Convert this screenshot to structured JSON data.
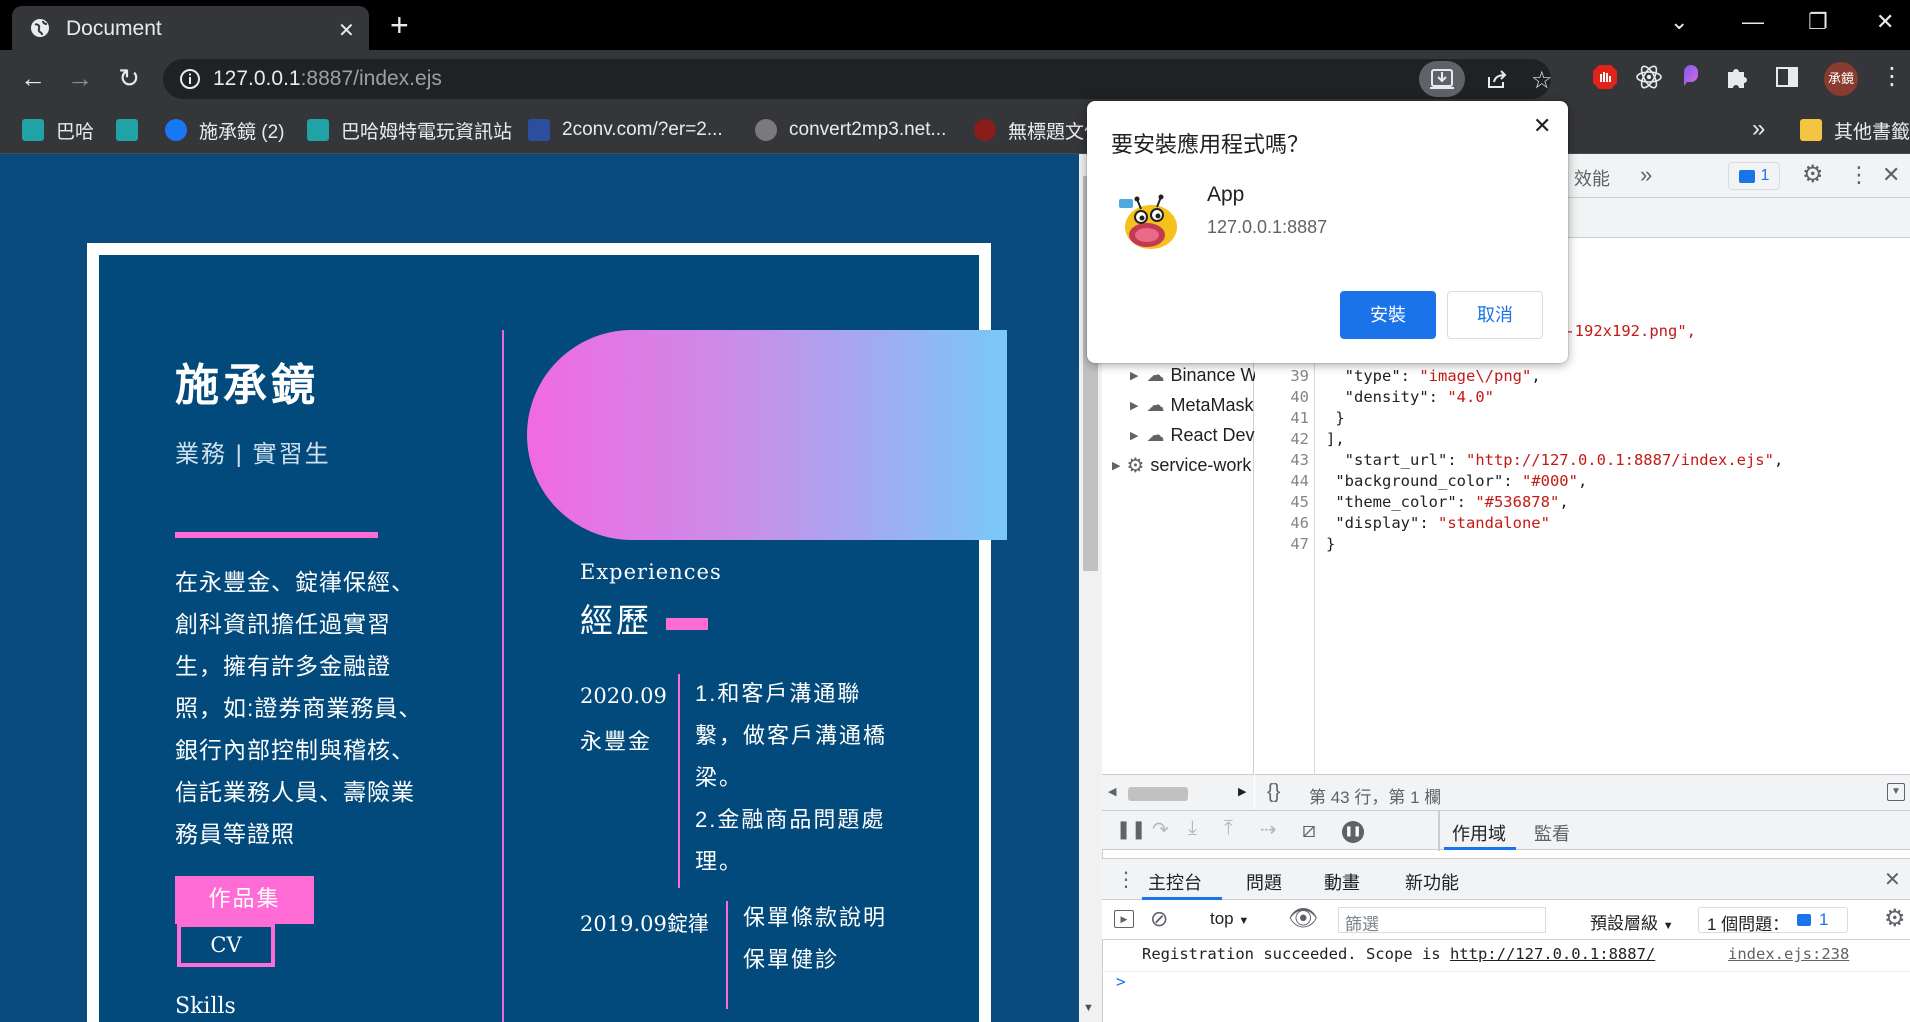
{
  "browser": {
    "tab_title": "Document",
    "url_host": "127.0.0.1",
    "url_rest": ":8887/index.ejs",
    "profile_label": "承鏡",
    "bookmarks": [
      {
        "label": "巴哈",
        "color": "#1fa3a6"
      },
      {
        "label": "",
        "color": "#1fa3a6"
      },
      {
        "label": "施承鏡 (2)",
        "color": "#1877f2"
      },
      {
        "label": "巴哈姆特電玩資訊站",
        "color": "#1fa3a6"
      },
      {
        "label": "2conv.com/?er=2...",
        "color": "#2b4f9e"
      },
      {
        "label": "convert2mp3.net...",
        "color": "#7a7a7a"
      },
      {
        "label": "無標題文件",
        "color": "#8b1c1c"
      }
    ],
    "bookmarks_more": "»",
    "other_bookmarks": "其他書籤"
  },
  "page": {
    "name": "施承鏡",
    "role": "業務 | 實習生",
    "bio": "在永豐金、錠嵂保經、創科資訊擔任過實習生，擁有許多金融證照，如:證券商業務員、銀行內部控制與稽核、信託業務人員、壽險業務員等證照",
    "portfolio_button": "作品集",
    "cv_button": "CV",
    "skills_heading": "Skills",
    "experience_en": "Experiences",
    "experience_zh": "經歷",
    "timeline": [
      {
        "date": "2020.09",
        "org": "永豐金",
        "lines": [
          "1.和客戶溝通聯",
          "繫，做客戶溝通橋",
          "梁。",
          "2.金融商品問題處",
          "理。"
        ]
      },
      {
        "date": "2019.09錠嵂",
        "org": "",
        "lines": [
          "保單條款說明",
          "保單健診"
        ]
      }
    ],
    "colors": {
      "background": "#034a7c",
      "accent": "#ff6cd6"
    }
  },
  "devtools": {
    "tabs": [
      "效能"
    ],
    "more_tabs": "»",
    "issues_count": "1",
    "tree": [
      {
        "label": "Binance W",
        "indent": 1
      },
      {
        "label": "MetaMask",
        "indent": 1
      },
      {
        "label": "React Dev",
        "indent": 1
      },
      {
        "label": "service-work",
        "indent": 0
      }
    ],
    "partial_code_line": "n-192x192.png\",",
    "code_lines": [
      {
        "num": "39",
        "text": "  \"type\": ",
        "str": "\"image\\/png\"",
        "tail": ","
      },
      {
        "num": "40",
        "text": "  \"density\": ",
        "str": "\"4.0\"",
        "tail": ""
      },
      {
        "num": "41",
        "text": " }",
        "str": "",
        "tail": ""
      },
      {
        "num": "42",
        "text": "],",
        "str": "",
        "tail": ""
      },
      {
        "num": "43",
        "text": "  \"start_url\": ",
        "str": "\"http://127.0.0.1:8887/index.ejs\"",
        "tail": ","
      },
      {
        "num": "44",
        "text": " \"background_color\": ",
        "str": "\"#000\"",
        "tail": ","
      },
      {
        "num": "45",
        "text": " \"theme_color\": ",
        "str": "\"#536878\"",
        "tail": ","
      },
      {
        "num": "46",
        "text": " \"display\": ",
        "str": "\"standalone\"",
        "tail": ""
      },
      {
        "num": "47",
        "text": "}",
        "str": "",
        "tail": ""
      }
    ],
    "cursor_position": "第 43 行，第 1 欄",
    "scope_tab": "作用域",
    "watch_tab": "監看",
    "drawer_tabs": [
      "主控台",
      "問題",
      "動畫",
      "新功能"
    ],
    "context_select": "top",
    "filter_placeholder": "篩選",
    "levels_select": "預設層級",
    "issues_label": "1 個問題：",
    "issues_badge": "1",
    "console_message": "Registration succeeded. Scope is ",
    "console_link": "http://127.0.0.1:8887/",
    "console_source": "index.ejs:238",
    "prompt": ">"
  },
  "dialog": {
    "title": "要安裝應用程式嗎？",
    "app_name": "App",
    "origin": "127.0.0.1:8887",
    "install_label": "安裝",
    "cancel_label": "取消"
  }
}
